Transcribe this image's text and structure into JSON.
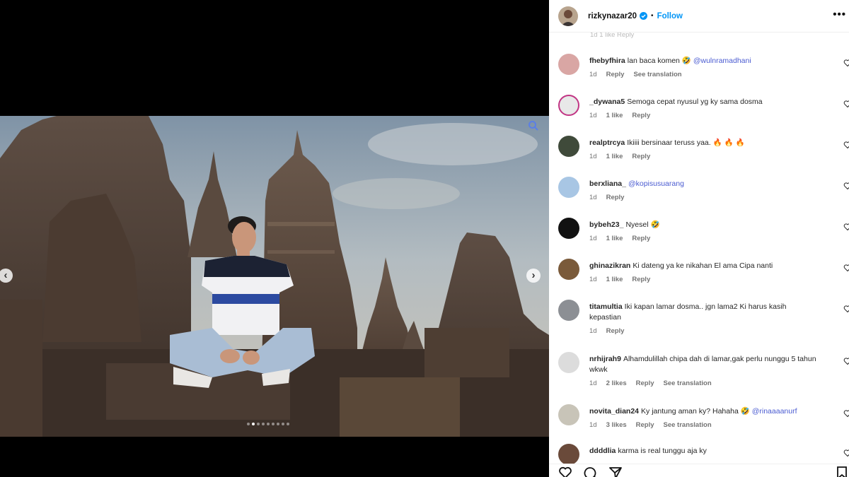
{
  "post": {
    "username": "rizkynazar20",
    "follow_label": "Follow",
    "separator": "•",
    "more_label": "•••",
    "verified_icon": "verified-badge-icon"
  },
  "media": {
    "carousel_total": 9,
    "carousel_active_index": 1,
    "prev_label": "‹",
    "next_label": "›"
  },
  "comments": {
    "ghost_meta": "1d   1 like   Reply",
    "items": [
      {
        "user": "fhebyfhira",
        "text": "lan baca komen",
        "emoji": "🤣",
        "mention": "@wulnramadhani",
        "time": "1d",
        "likes": "",
        "reply": "Reply",
        "translate": "See translation"
      },
      {
        "user": "_dywana5",
        "text": "Semoga cepat nyusul yg ky sama dosma",
        "emoji": "",
        "mention": "",
        "time": "1d",
        "likes": "1 like",
        "reply": "Reply",
        "translate": ""
      },
      {
        "user": "realptrcya",
        "text": "Ikiiii bersinaar teruss yaa.",
        "emoji": "🔥 🔥 🔥",
        "mention": "",
        "time": "1d",
        "likes": "1 like",
        "reply": "Reply",
        "translate": ""
      },
      {
        "user": "berxliana_",
        "text": "",
        "emoji": "",
        "mention": "@kopisusuarang",
        "time": "1d",
        "likes": "",
        "reply": "Reply",
        "translate": ""
      },
      {
        "user": "bybeh23_",
        "text": "Nyesel",
        "emoji": "🤣",
        "mention": "",
        "time": "1d",
        "likes": "1 like",
        "reply": "Reply",
        "translate": ""
      },
      {
        "user": "ghinazikran",
        "text": "Ki dateng ya ke nikahan El ama Cipa nanti",
        "emoji": "",
        "mention": "",
        "time": "1d",
        "likes": "1 like",
        "reply": "Reply",
        "translate": ""
      },
      {
        "user": "titamultia",
        "text": "Iki kapan lamar dosma.. jgn lama2 Ki harus kasih kepastian",
        "emoji": "",
        "mention": "",
        "time": "1d",
        "likes": "",
        "reply": "Reply",
        "translate": ""
      },
      {
        "user": "nrhijrah9",
        "text": "Alhamdulillah chipa dah di lamar,gak perlu nunggu 5 tahun wkwk",
        "emoji": "",
        "mention": "",
        "time": "1d",
        "likes": "2 likes",
        "reply": "Reply",
        "translate": "See translation"
      },
      {
        "user": "novita_dian24",
        "text": "Ky jantung aman ky? Hahaha",
        "emoji": "🤣",
        "mention": "@rinaaaanurf",
        "time": "1d",
        "likes": "3 likes",
        "reply": "Reply",
        "translate": "See translation"
      },
      {
        "user": "ddddlia",
        "text": "karma is real tunggu aja ky",
        "emoji": "",
        "mention": "",
        "time": "",
        "likes": "",
        "reply": "",
        "translate": ""
      }
    ]
  },
  "icons": {
    "like": "heart-icon",
    "comment": "comment-icon",
    "share": "share-icon",
    "save": "bookmark-icon",
    "zoom": "zoom-icon"
  },
  "colors": {
    "follow": "#0095f6",
    "mention": "#4a5bd1",
    "meta": "#737373"
  }
}
